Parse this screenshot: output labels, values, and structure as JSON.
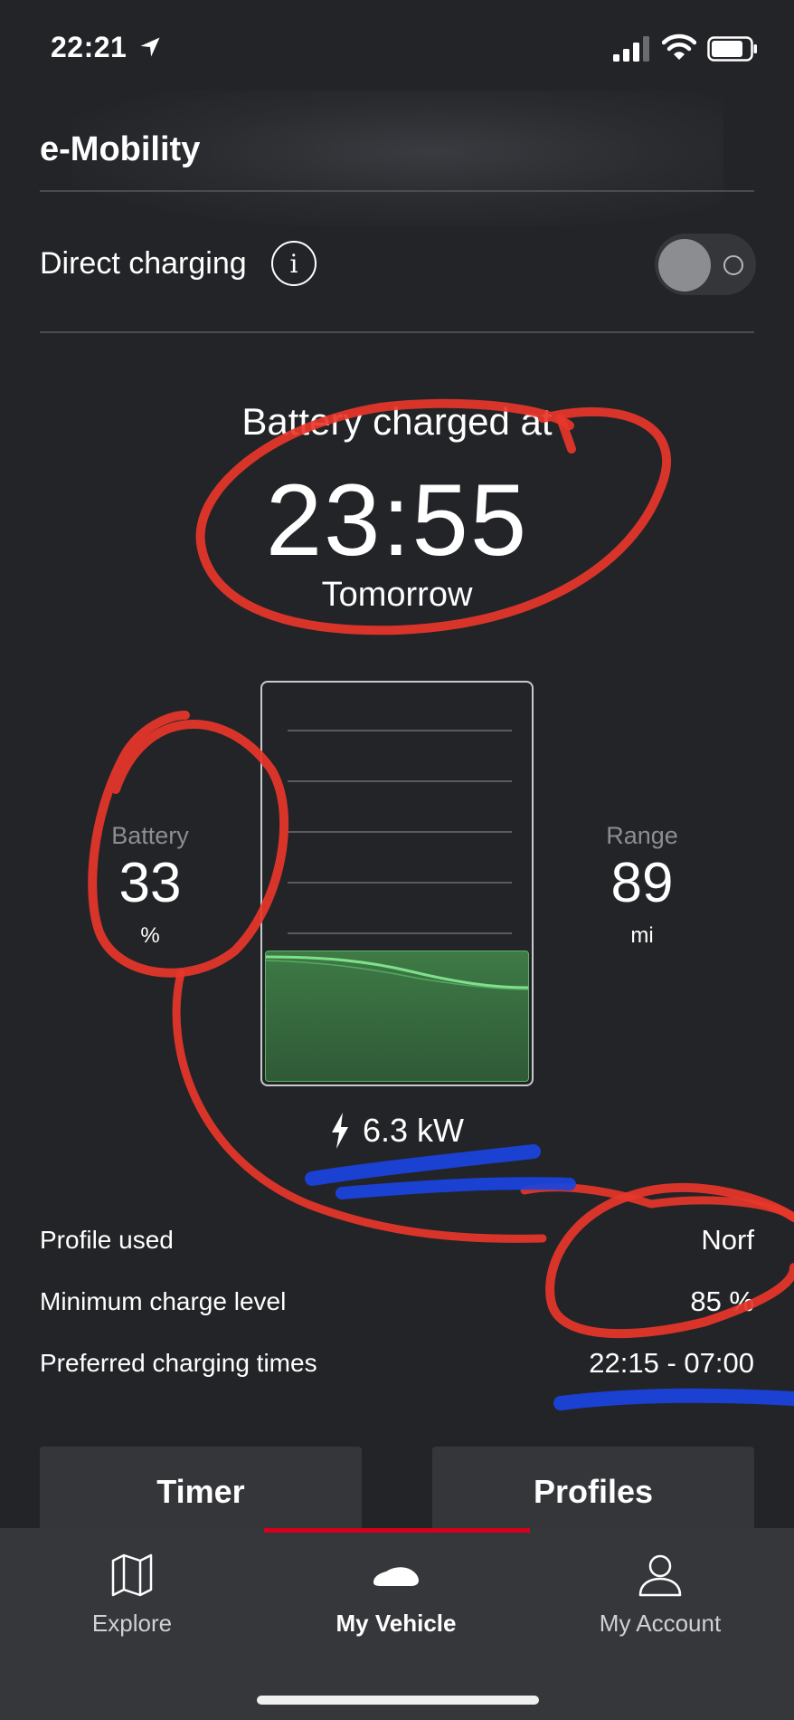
{
  "status_bar": {
    "time": "22:21"
  },
  "header": {
    "title": "e-Mobility"
  },
  "direct_charging": {
    "label": "Direct charging",
    "info_glyph": "i",
    "enabled": false
  },
  "charge_eta": {
    "label": "Battery charged at",
    "time": "23:55",
    "day": "Tomorrow"
  },
  "battery": {
    "label": "Battery",
    "value": "33",
    "unit": "%",
    "level_fraction": 0.33
  },
  "range": {
    "label": "Range",
    "value": "89",
    "unit": "mi"
  },
  "charging_power": "6.3 kW",
  "details": [
    {
      "label": "Profile used",
      "value": "Norf"
    },
    {
      "label": "Minimum charge level",
      "value": "85 %"
    },
    {
      "label": "Preferred charging times",
      "value": "22:15 - 07:00"
    }
  ],
  "actions": {
    "timer_label": "Timer",
    "profiles_label": "Profiles"
  },
  "tabs": [
    {
      "label": "Explore",
      "icon": "map-icon",
      "active": false
    },
    {
      "label": "My Vehicle",
      "icon": "car-icon",
      "active": true
    },
    {
      "label": "My Account",
      "icon": "user-icon",
      "active": false
    }
  ],
  "colors": {
    "accent": "#d5001c",
    "charge_green": "#3e7a46",
    "annotation_red": "#e8362a",
    "annotation_blue": "#1a44e0"
  }
}
